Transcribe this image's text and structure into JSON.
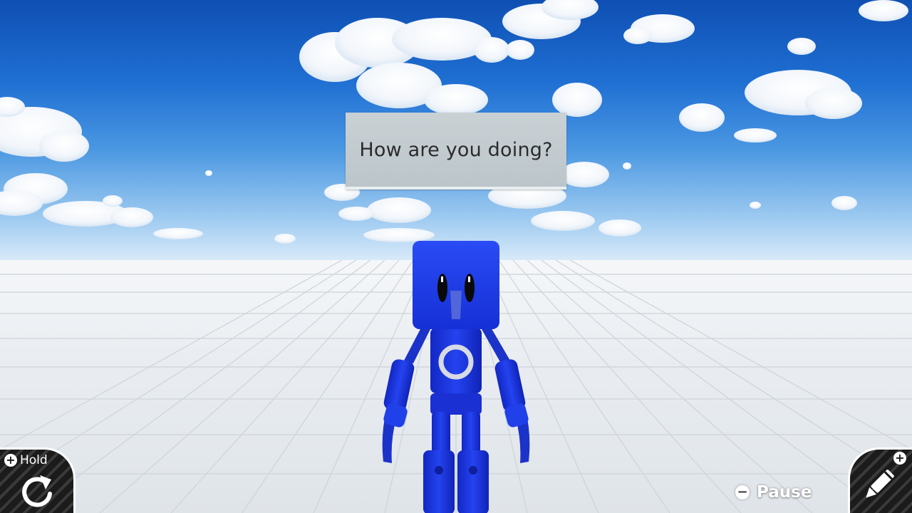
{
  "scene": {
    "speech_text": "How are you doing?",
    "sky_color": "#1f6fd3",
    "floor_color": "#e9edf1",
    "character_color": "#1a33e0",
    "character_icon": "circle-emblem"
  },
  "controls": {
    "hold": {
      "badge": "+",
      "label": "Hold",
      "icon": "rotate-icon"
    },
    "edit": {
      "badge": "+",
      "icon": "pencil-icon"
    },
    "pause": {
      "badge": "−",
      "label": "Pause"
    }
  }
}
